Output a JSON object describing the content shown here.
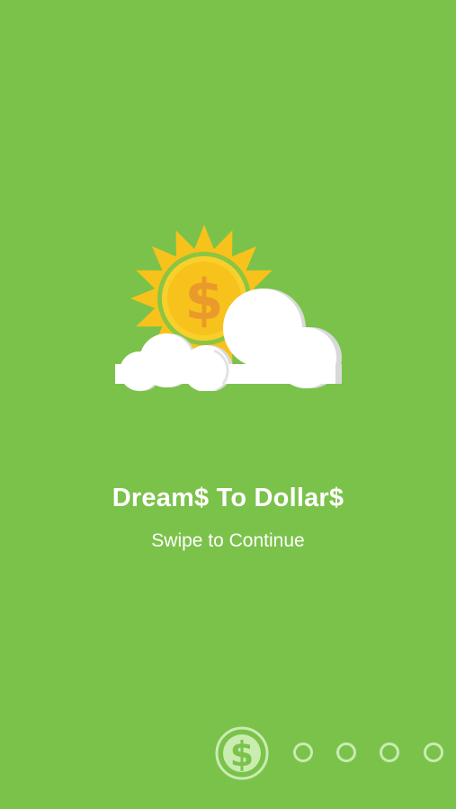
{
  "onboarding": {
    "title": "Dream$ To Dollar$",
    "subtitle": "Swipe to Continue",
    "illustration": {
      "sun_symbol": "$",
      "icon": "sun-dollar-cloud-icon"
    },
    "pager": {
      "logo_symbol": "$",
      "logo_icon": "dollar-coin-logo-icon",
      "dots": 4,
      "current_page": 1
    }
  },
  "colors": {
    "background": "#7bc24a",
    "sun_rays": "#f7c21b",
    "coin": "#f9d02b",
    "coin_ring": "#8cc542",
    "dollar": "#ea9a2b",
    "cloud": "#ffffff",
    "cloud_shadow": "#d9d9d9",
    "pager": "#c9ecb1"
  }
}
